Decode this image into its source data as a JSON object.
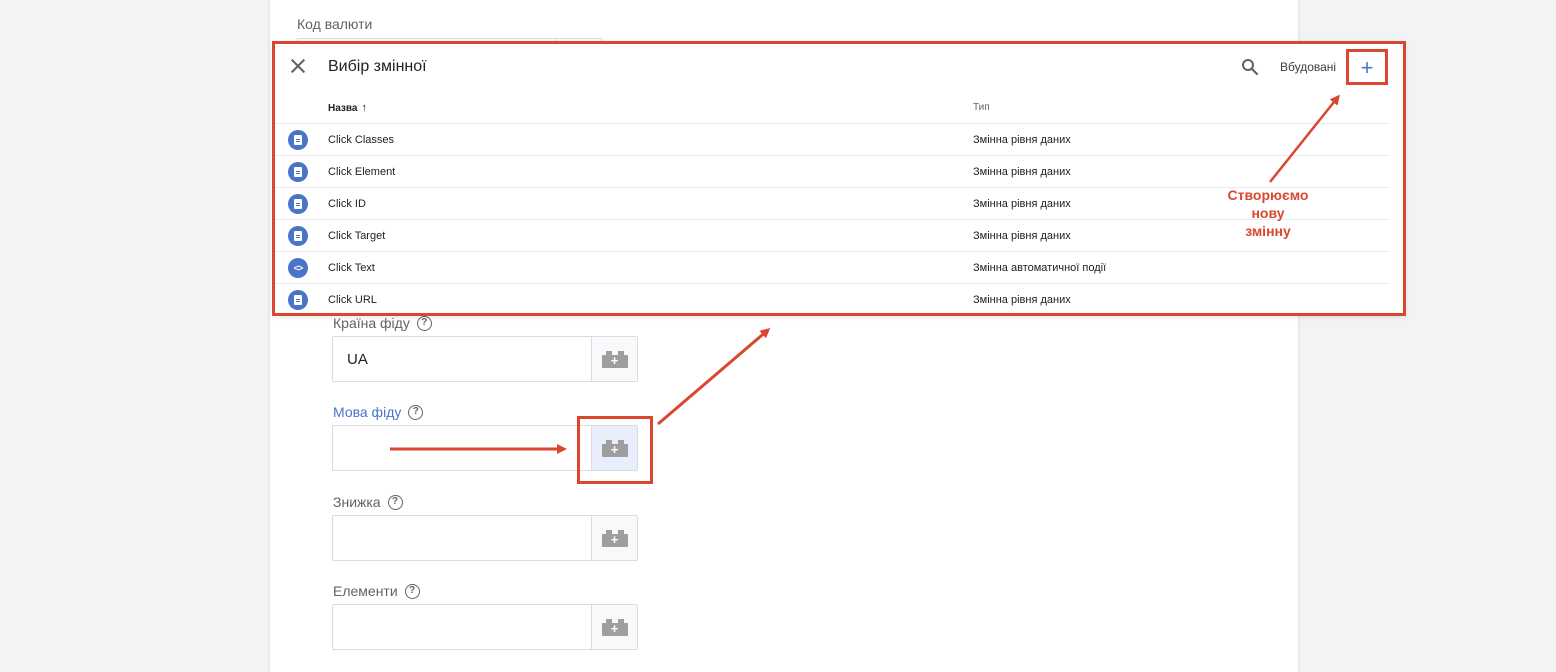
{
  "background_form": {
    "currency_label": "Код валюти",
    "fields": [
      {
        "label": "Країна фіду",
        "value": "UA",
        "active": false
      },
      {
        "label": "Мова фіду",
        "value": "",
        "active": true
      },
      {
        "label": "Знижка",
        "value": "",
        "active": false
      },
      {
        "label": "Елементи",
        "value": "",
        "active": false
      }
    ],
    "help_glyph": "?",
    "var_button_glyph": "+"
  },
  "dialog": {
    "title": "Вибір змінної",
    "builtin_label": "Вбудовані",
    "add_glyph": "+",
    "columns": {
      "name": "Назва",
      "sort": "↑",
      "type": "Тип"
    },
    "rows": [
      {
        "name": "Click Classes",
        "type": "Змінна рівня даних",
        "icon": "document-icon"
      },
      {
        "name": "Click Element",
        "type": "Змінна рівня даних",
        "icon": "document-icon"
      },
      {
        "name": "Click ID",
        "type": "Змінна рівня даних",
        "icon": "document-icon"
      },
      {
        "name": "Click Target",
        "type": "Змінна рівня даних",
        "icon": "document-icon"
      },
      {
        "name": "Click Text",
        "type": "Змінна автоматичної події",
        "icon": "code-icon"
      },
      {
        "name": "Click URL",
        "type": "Змінна рівня даних",
        "icon": "document-icon"
      }
    ]
  },
  "annotation": {
    "text_line1": "Створюємо",
    "text_line2": "нову",
    "text_line3": "змінну",
    "color": "#d9472f"
  },
  "colors": {
    "accent": "#4a74c9",
    "annotation": "#d9472f"
  }
}
